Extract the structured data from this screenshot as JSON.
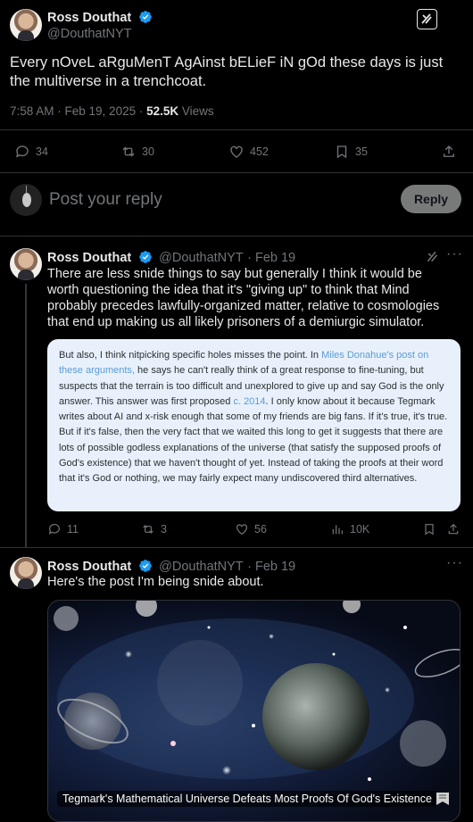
{
  "main_tweet": {
    "author_name": "Ross Douthat",
    "author_handle": "@DouthatNYT",
    "text": "Every nOveL aRguMenT AgAinst bELieF iN gOd these days is just the multiverse in a trenchcoat.",
    "time": "7:58 AM · Feb 19, 2025 · ",
    "views_count": "52.5K",
    "views_label": " Views",
    "replies": "34",
    "reposts": "30",
    "likes": "452",
    "bookmarks": "35"
  },
  "reply_box": {
    "placeholder": "Post your reply",
    "button_label": "Reply"
  },
  "reply1": {
    "author_name": "Ross Douthat",
    "author_handle": "@DouthatNYT",
    "date": "· Feb 19",
    "text": "There are less snide things to say but generally I think it would be worth questioning the idea that it's \"giving up\" to think that Mind probably precedes lawfully-organized matter, relative to cosmologies that end up making us all likely prisoners of a demiurgic simulator.",
    "quote": {
      "p1": "But also, I think nitpicking specific holes misses the point. In ",
      "link1": "Miles Donahue's post on these arguments,",
      "p2": " he says he can't really think of a great response to fine-tuning, but suspects that the terrain is too difficult and unexplored to give up and say God is the only answer. This answer was first proposed ",
      "link2": "c. 2014",
      "p3": ". I only know about it because Tegmark writes about AI and x-risk enough that some of my friends are big fans. If it's true, it's true. But if it's false, then the very fact that we waited this long to get it suggests that there are lots of possible godless explanations of the universe (that satisfy the supposed proofs of God's existence) that we haven't thought of yet. Instead of taking the proofs at their word that it's God or nothing, we may fairly expect many undiscovered third alternatives."
    },
    "replies": "11",
    "reposts": "3",
    "likes": "56",
    "views": "10K"
  },
  "reply2": {
    "author_name": "Ross Douthat",
    "author_handle": "@DouthatNYT",
    "date": "· Feb 19",
    "text": "Here's the post I'm being snide about.",
    "card_caption": "Tegmark's Mathematical Universe Defeats Most Proofs Of God's Existence"
  },
  "colors": {
    "accent": "#1d9bf0",
    "quote_bg": "#e8f1fb",
    "link": "#5b9bd5",
    "reply_button_bg": "#787a7a"
  }
}
